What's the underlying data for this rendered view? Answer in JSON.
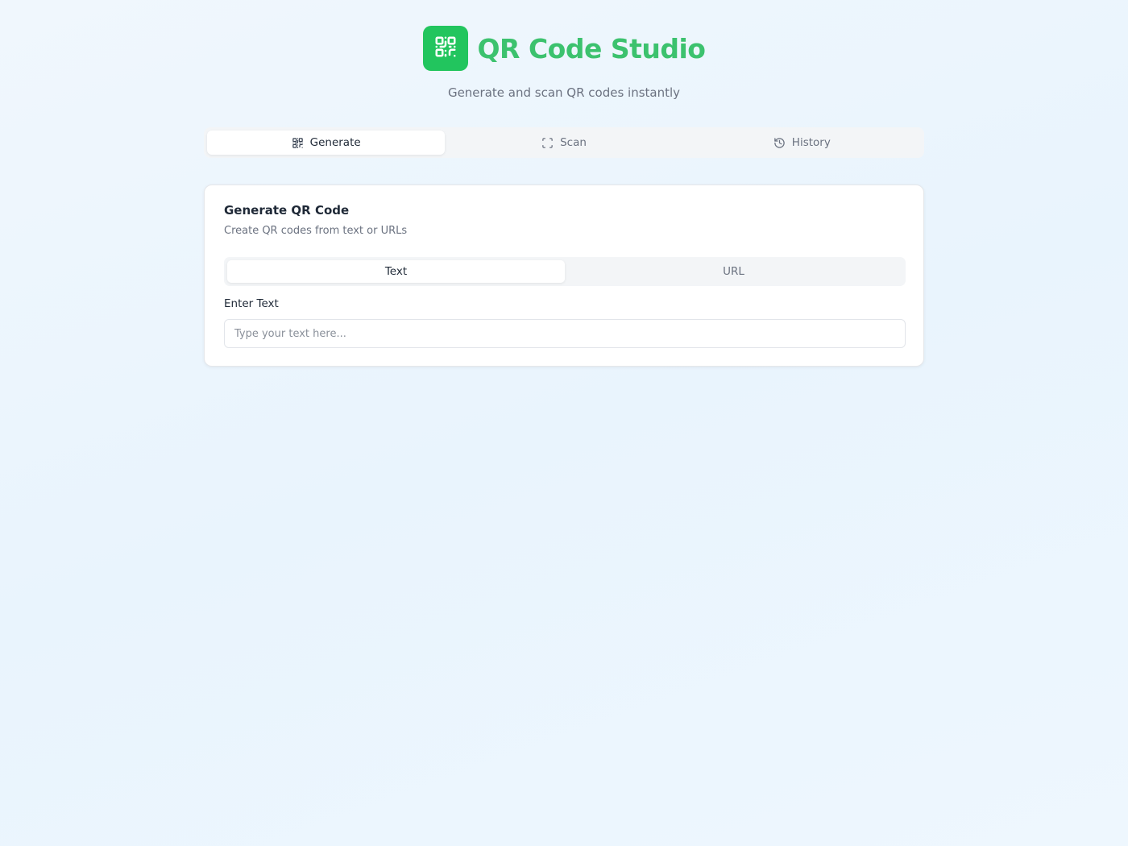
{
  "header": {
    "logo_icon": "qr-code-icon",
    "title": "QR Code Studio",
    "subtitle": "Generate and scan QR codes instantly"
  },
  "main_tabs": [
    {
      "label": "Generate",
      "icon": "qr-code-icon",
      "active": true
    },
    {
      "label": "Scan",
      "icon": "scan-frame-icon",
      "active": false
    },
    {
      "label": "History",
      "icon": "history-icon",
      "active": false
    }
  ],
  "card": {
    "title": "Generate QR Code",
    "description": "Create QR codes from text or URLs",
    "sub_tabs": [
      {
        "label": "Text",
        "active": true
      },
      {
        "label": "URL",
        "active": false
      }
    ],
    "field_label": "Enter Text",
    "input_value": "",
    "input_placeholder": "Type your text here..."
  },
  "colors": {
    "brand_green": "#22c55e",
    "title_green": "#3cc26e",
    "background": "#eef6fd"
  }
}
